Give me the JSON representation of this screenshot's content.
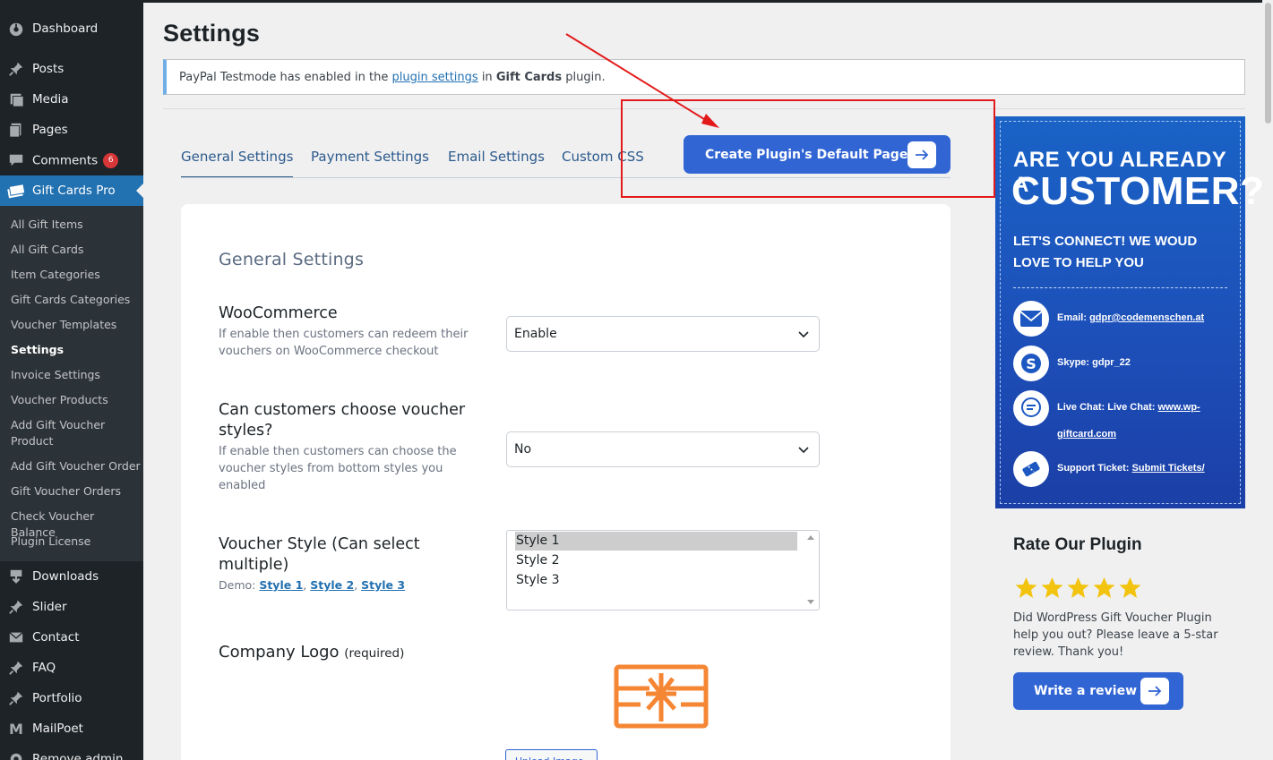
{
  "sidebar": {
    "menu": [
      {
        "label": "Dashboard",
        "icon": "dashboard-icon"
      },
      {
        "label": "Posts",
        "icon": "pin-icon"
      },
      {
        "label": "Media",
        "icon": "media-icon"
      },
      {
        "label": "Pages",
        "icon": "pages-icon"
      },
      {
        "label": "Comments",
        "icon": "comments-icon",
        "badge": "6"
      },
      {
        "label": "Gift Cards Pro",
        "icon": "gift-cards-icon"
      }
    ],
    "submenu": [
      "All Gift Items",
      "All Gift Cards",
      "Item Categories",
      "Gift Cards Categories",
      "Voucher Templates",
      "Settings",
      "Invoice Settings",
      "Voucher Products",
      "Add Gift Voucher Product",
      "Add Gift Voucher Order",
      "Gift Voucher Orders",
      "Check Voucher Balance",
      "Plugin License"
    ],
    "current_submenu": "Settings",
    "menu_lower": [
      {
        "label": "Downloads",
        "icon": "downloads-icon"
      },
      {
        "label": "Slider",
        "icon": "pin-icon"
      },
      {
        "label": "Contact",
        "icon": "mail-icon"
      },
      {
        "label": "FAQ",
        "icon": "pin-icon"
      },
      {
        "label": "Portfolio",
        "icon": "pin-icon"
      },
      {
        "label": "MailPoet",
        "icon": "mailpoet-icon"
      },
      {
        "label": "Remove admin",
        "icon": "gear-icon"
      }
    ]
  },
  "page": {
    "title": "Settings",
    "notice": {
      "prefix": "PayPal Testmode has enabled in the ",
      "link": "plugin settings",
      "middle": " in ",
      "plugin": "Gift Cards",
      "suffix": " plugin."
    }
  },
  "tabs": [
    "General Settings",
    "Payment Settings",
    "Email Settings",
    "Custom CSS"
  ],
  "active_tab": "General Settings",
  "create_button": "Create Plugin's Default Pages",
  "form": {
    "section_title": "General Settings",
    "woocommerce": {
      "title": "WooCommerce",
      "desc": "If enable then customers can redeem their vouchers on WooCommerce checkout",
      "value": "Enable"
    },
    "choose_styles": {
      "title": "Can customers choose voucher styles?",
      "desc": "If enable then customers can choose the voucher styles from bottom styles you enabled",
      "value": "No"
    },
    "voucher_style": {
      "title": "Voucher Style (Can select multiple)",
      "demo_label": "Demo: ",
      "demo_links": [
        "Style 1",
        "Style 2",
        "Style 3"
      ],
      "options": [
        "Style 1",
        "Style 2",
        "Style 3"
      ],
      "selected": "Style 1"
    },
    "company_logo": {
      "title": "Company Logo",
      "required": "(required)",
      "upload_label": "Upload Image"
    }
  },
  "promo": {
    "line1": "ARE YOU ALREADY A",
    "line2": "CUSTOMER?",
    "sub": "LET'S CONNECT! WE WOUD LOVE TO HELP YOU",
    "contacts": [
      {
        "icon": "email-icon",
        "label": "Email: ",
        "value": "gdpr@codemenschen.at"
      },
      {
        "icon": "skype-icon",
        "label": "Skype: gdpr_22",
        "value": ""
      },
      {
        "icon": "chat-icon",
        "label": "Live Chat: Live Chat: ",
        "value": "www.wp-giftcard.com"
      },
      {
        "icon": "ticket-icon",
        "label": "Support Ticket: ",
        "value": "Submit Tickets/"
      }
    ]
  },
  "rate": {
    "title": "Rate Our Plugin",
    "stars": 5,
    "desc": "Did WordPress Gift Voucher Plugin help you out? Please leave a 5-star review. Thank you!",
    "button": "Write a review"
  },
  "colors": {
    "accent": "#3165d4",
    "sidebar_bg": "#1d2327",
    "active_menu": "#2271b1",
    "annotation": "#e31a1a",
    "star": "#f2c40f",
    "logo_orange": "#f58634"
  }
}
